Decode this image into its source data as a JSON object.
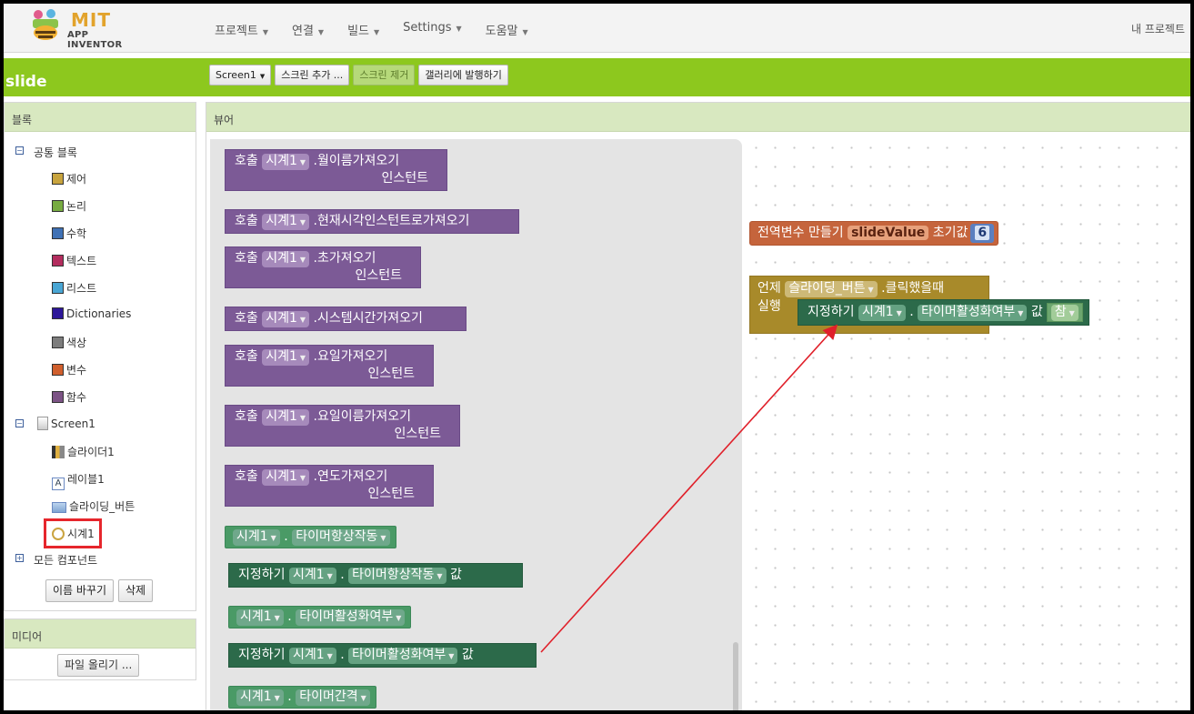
{
  "app": {
    "logo_top": "MIT",
    "logo_bottom": "APP INVENTOR",
    "project_name": "slide",
    "my_projects": "내 프로젝트"
  },
  "menu": [
    "프로젝트",
    "연결",
    "빌드",
    "Settings",
    "도움말"
  ],
  "toolbar": {
    "screen_select": "Screen1",
    "add_screen": "스크린 추가 ...",
    "remove_screen": "스크린 제거",
    "publish": "갤러리에 발행하기"
  },
  "blocks_panel": {
    "title": "블록",
    "builtin_label": "공통 블록",
    "builtin_items": [
      {
        "label": "제어",
        "color": "#c8a43e"
      },
      {
        "label": "논리",
        "color": "#77ab41"
      },
      {
        "label": "수학",
        "color": "#3f71b5"
      },
      {
        "label": "텍스트",
        "color": "#b32d5e"
      },
      {
        "label": "리스트",
        "color": "#49a6d4"
      },
      {
        "label": "Dictionaries",
        "color": "#2d1799"
      },
      {
        "label": "색상",
        "color": "#7d7d7d"
      },
      {
        "label": "변수",
        "color": "#d05f2d"
      },
      {
        "label": "함수",
        "color": "#7c5385"
      }
    ],
    "screen_label": "Screen1",
    "components": [
      "슬라이더1",
      "레이블1",
      "슬라이딩_버튼",
      "시계1"
    ],
    "all_components": "모든 컴포넌트",
    "rename_button": "이름 바꾸기",
    "delete_button": "삭제"
  },
  "media_panel": {
    "title": "미디어",
    "upload_button": "파일 올리기 ..."
  },
  "viewer": {
    "title": "뷰어"
  },
  "flyout": {
    "call_word": "호출",
    "component": "시계1",
    "instant_word": "인스턴트",
    "set_word": "지정하기",
    "to_word": "값",
    "call_blocks": [
      ".월이름가져오기",
      ".현재시각인스턴트로가져오기",
      ".초가져오기",
      ".시스템시간가져오기",
      ".요일가져오기",
      ".요일이름가져오기",
      ".연도가져오기"
    ],
    "props": [
      "타이머항상작동",
      "타이머활성화여부",
      "타이머간격"
    ]
  },
  "workspace": {
    "global_block": {
      "label": "전역변수",
      "make": "만들기",
      "name": "slideValue",
      "init": "초기값",
      "value": "6"
    },
    "event_block": {
      "when": "언제",
      "component": "슬라이딩_버튼",
      "event": ".클릭했을때",
      "do": "실행"
    },
    "set_block": {
      "set": "지정하기",
      "component": "시계1",
      "property": "타이머활성화여부",
      "to": "값",
      "value": "참"
    }
  },
  "annotation": {
    "arrow_color": "#e0202a"
  }
}
